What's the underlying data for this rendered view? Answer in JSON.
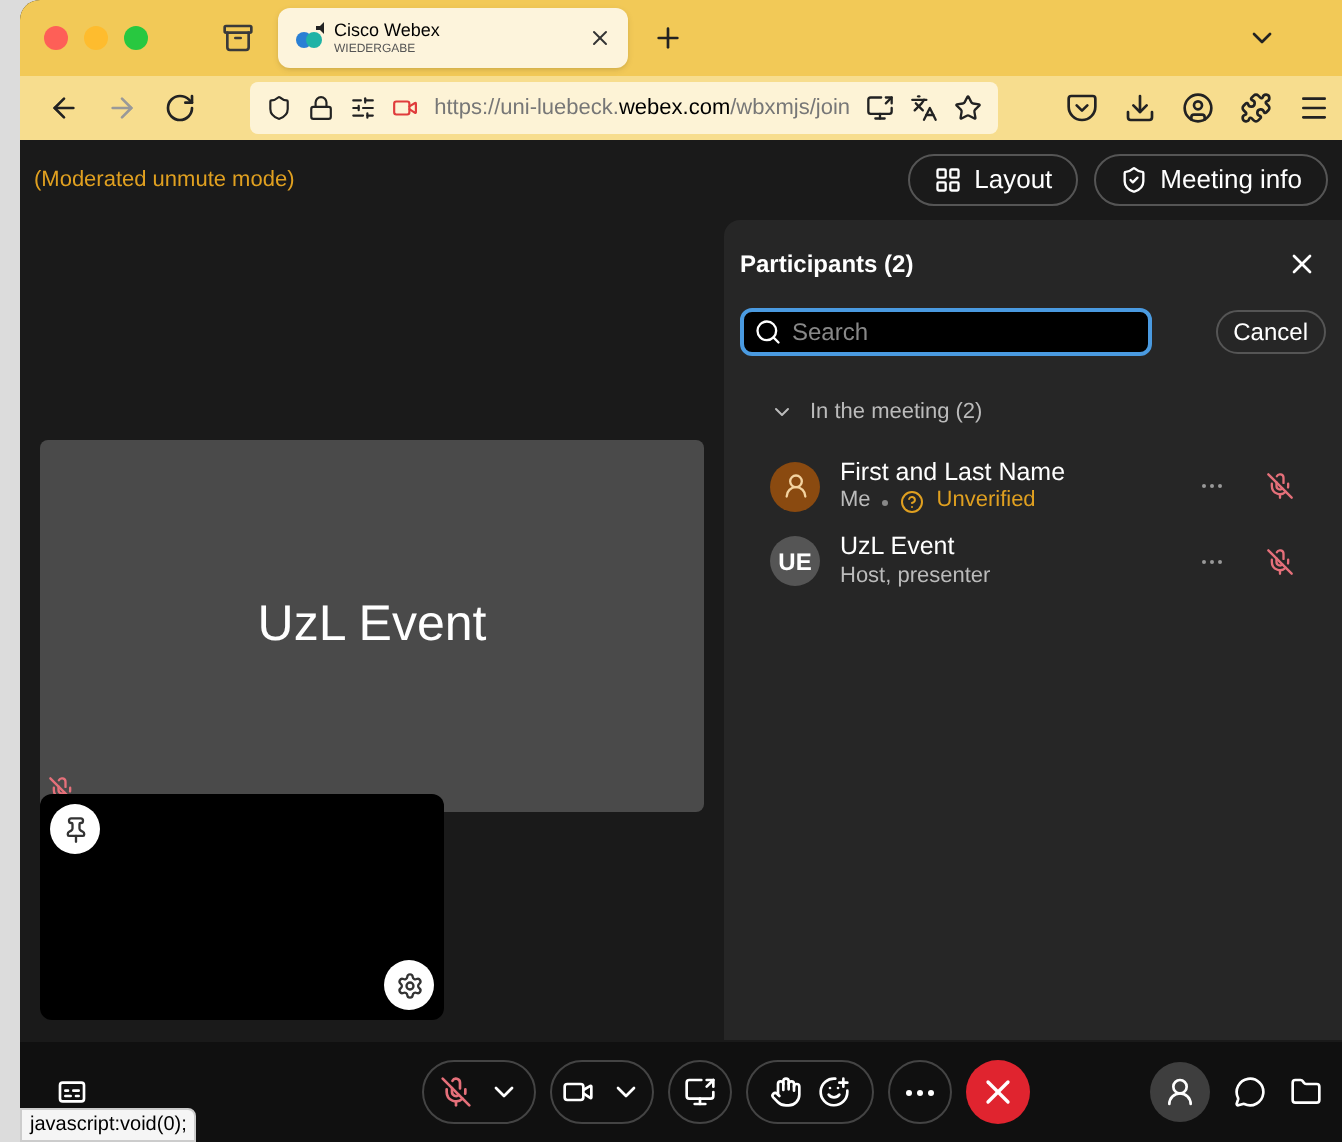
{
  "browser": {
    "tab": {
      "title": "Cisco Webex",
      "subtitle": "WIEDERGABE",
      "selected": true
    },
    "url": {
      "scheme_host": "https://uni-luebeck.",
      "domain": "webex.com",
      "path": "/wbxmjs/join"
    }
  },
  "meeting": {
    "notice": "(Moderated unmute mode)",
    "buttons": [
      {
        "kind": "layout",
        "label": "Layout"
      },
      {
        "kind": "info",
        "label": "Meeting info"
      }
    ]
  },
  "stage": {
    "tile_name": "UzL Event",
    "tile_muted": true
  },
  "participants": {
    "title": "Participants (2)",
    "search": {
      "placeholder": "Search"
    },
    "cancel": "Cancel",
    "section": {
      "label": "In the meeting (2)",
      "expanded": true
    },
    "items": [
      {
        "kind": "self",
        "name": "First and Last Name",
        "detail": "Me",
        "status": "Unverified",
        "muted": true
      },
      {
        "kind": "initials",
        "initials": "UE",
        "name": "UzL Event",
        "detail": "Host, presenter",
        "muted": true
      }
    ]
  },
  "toolbar": {
    "muted": true,
    "participants_open": true
  },
  "status_bar": "javascript:void(0);"
}
